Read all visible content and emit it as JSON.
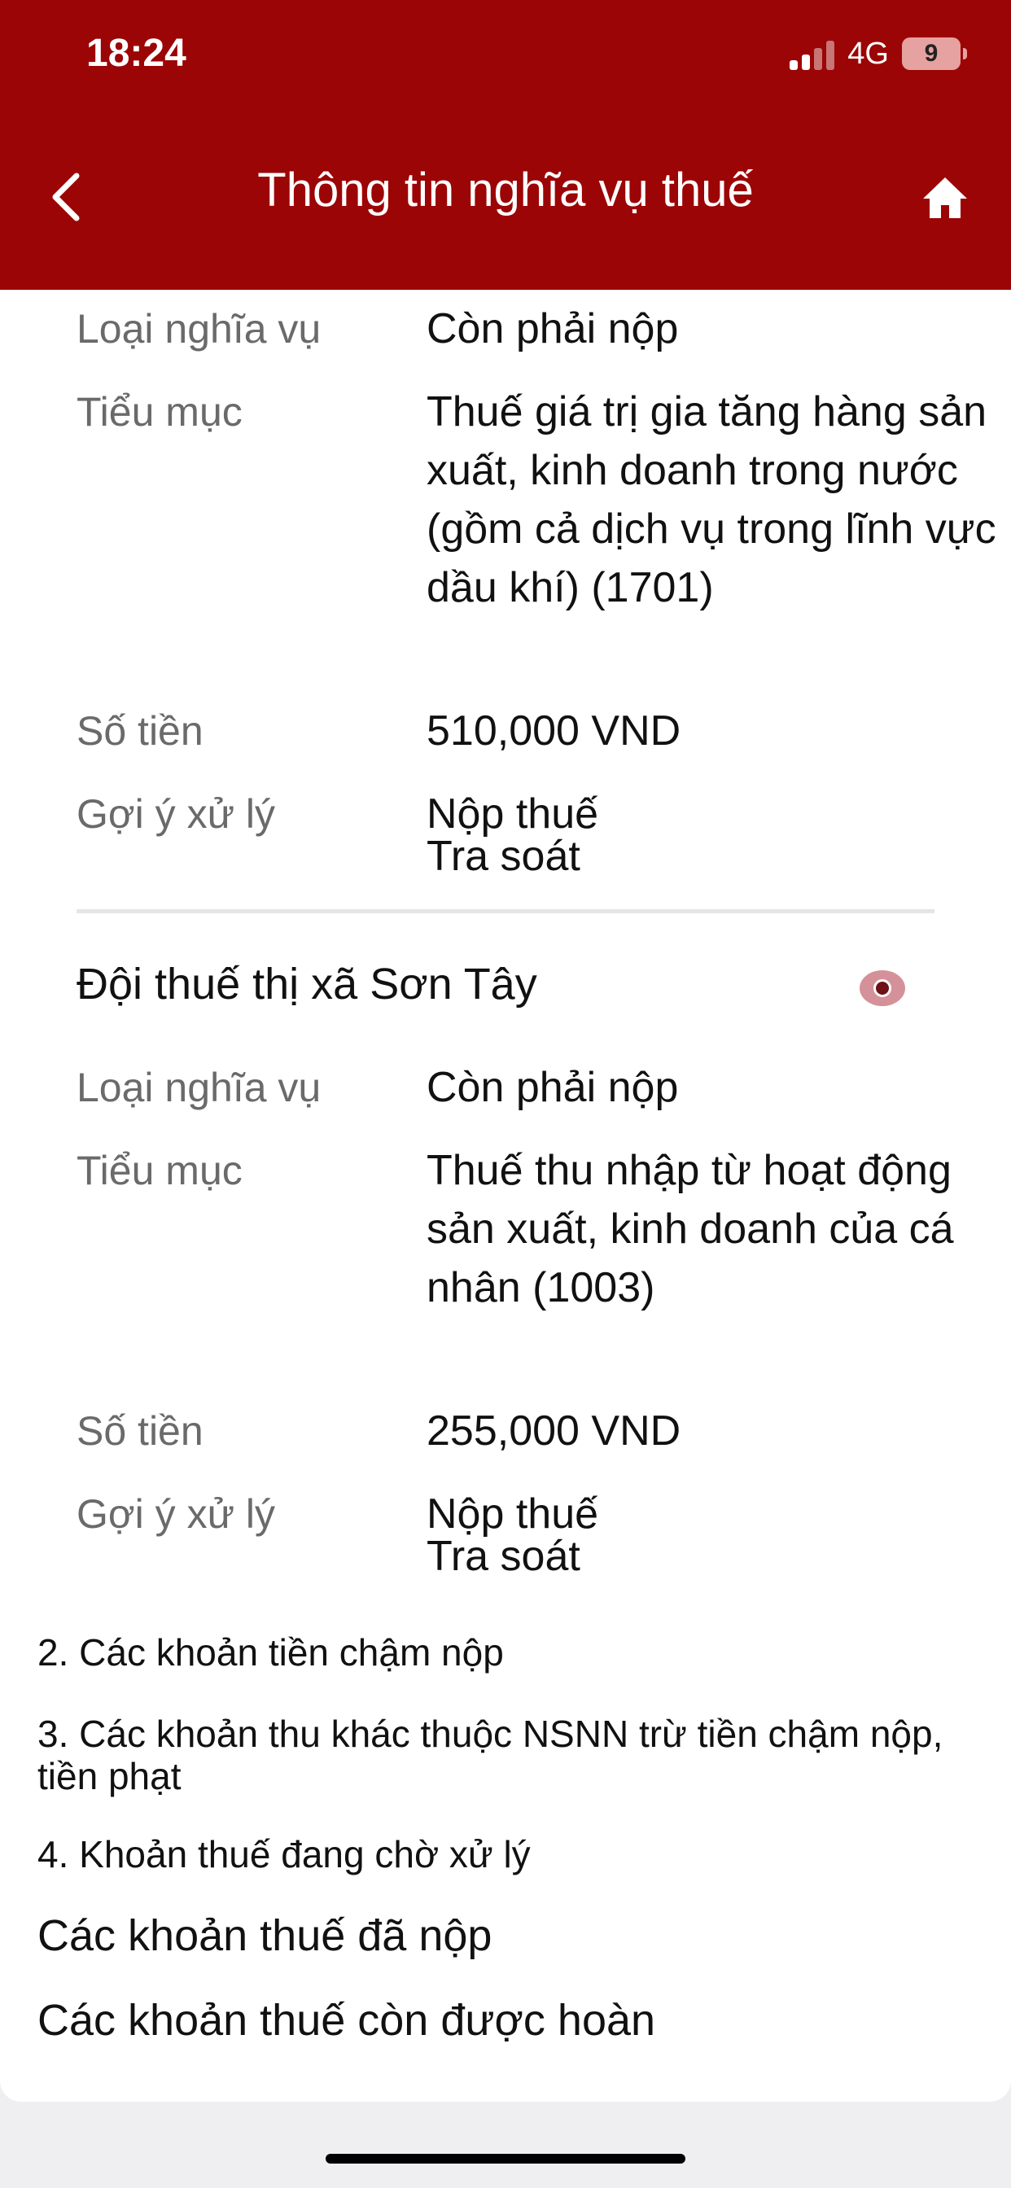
{
  "status_bar": {
    "time": "18:24",
    "network": "4G",
    "battery": "9"
  },
  "header": {
    "title": "Thông tin nghĩa vụ thuế"
  },
  "obligation_1": {
    "type_label": "Loại nghĩa vụ",
    "type_value": "Còn phải nộp",
    "submenu_label": "Tiểu mục",
    "submenu_value": "Thuế giá trị gia tăng hàng sản xuất, kinh doanh trong nước (gồm cả dịch vụ trong lĩnh vực dầu khí) (1701)",
    "amount_label": "Số tiền",
    "amount_value": "510,000 VND",
    "suggest_label": "Gợi ý xử lý",
    "action_pay": "Nộp thuế",
    "action_review": "Tra soát"
  },
  "obligation_2": {
    "authority": "Đội thuế thị xã Sơn Tây",
    "type_label": "Loại nghĩa vụ",
    "type_value": "Còn phải nộp",
    "submenu_label": "Tiểu mục",
    "submenu_value": "Thuế thu nhập từ hoạt động sản xuất, kinh doanh của cá nhân (1003)",
    "amount_label": "Số tiền",
    "amount_value": "255,000 VND",
    "suggest_label": "Gợi ý xử lý",
    "action_pay": "Nộp thuế",
    "action_review": "Tra soát"
  },
  "sections": {
    "late_payment": "2. Các khoản tiền chậm nộp",
    "other_revenue": "3. Các khoản thu khác thuộc NSNN trừ tiền chậm nộp, tiền phạt",
    "pending": "4. Khoản thuế đang chờ xử lý",
    "paid": "Các khoản thuế đã nộp",
    "refundable": "Các khoản thuế còn được hoàn"
  },
  "icons": {
    "back": "chevron-left-icon",
    "home": "home-icon",
    "view": "eye-icon"
  },
  "colors": {
    "header_bg": "#9c0505",
    "eye_bg": "#d4919a",
    "eye_dot": "#6f0f16"
  }
}
